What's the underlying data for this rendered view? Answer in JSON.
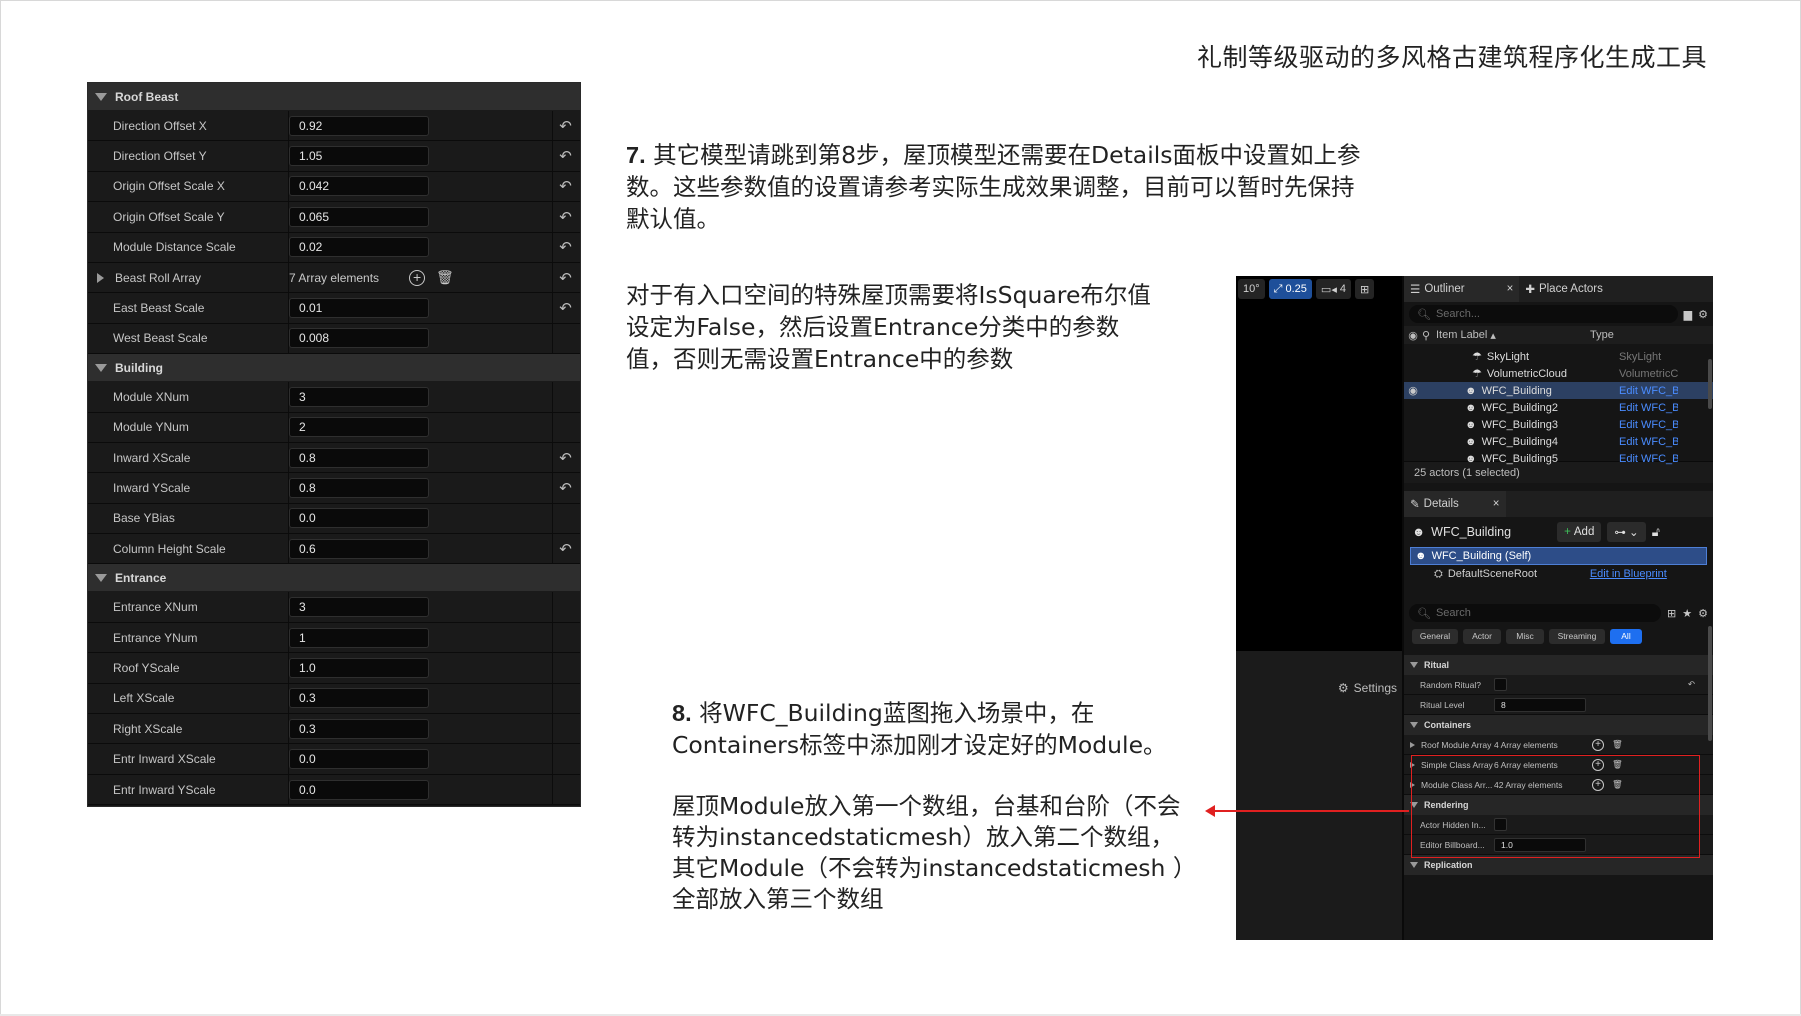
{
  "slide": {
    "title": "礼制等级驱动的多风格古建筑程序化生成工具"
  },
  "left_panel": {
    "sections": [
      {
        "name": "Roof Beast",
        "rows": [
          {
            "label": "Direction Offset X",
            "value": "0.92",
            "reset": true
          },
          {
            "label": "Direction Offset Y",
            "value": "1.05",
            "reset": true
          },
          {
            "label": "Origin Offset Scale X",
            "value": "0.042",
            "reset": true
          },
          {
            "label": "Origin Offset Scale Y",
            "value": "0.065",
            "reset": true
          },
          {
            "label": "Module Distance Scale",
            "value": "0.02",
            "reset": true
          },
          {
            "label": "Beast Roll Array",
            "value": "7 Array elements",
            "reset": true,
            "array": true
          },
          {
            "label": "East Beast Scale",
            "value": "0.01",
            "reset": true
          },
          {
            "label": "West Beast Scale",
            "value": "0.008",
            "reset": false
          }
        ]
      },
      {
        "name": "Building",
        "rows": [
          {
            "label": "Module XNum",
            "value": "3",
            "reset": false
          },
          {
            "label": "Module YNum",
            "value": "2",
            "reset": false
          },
          {
            "label": "Inward XScale",
            "value": "0.8",
            "reset": true
          },
          {
            "label": "Inward YScale",
            "value": "0.8",
            "reset": true
          },
          {
            "label": "Base YBias",
            "value": "0.0",
            "reset": false
          },
          {
            "label": "Column Height Scale",
            "value": "0.6",
            "reset": true
          }
        ]
      },
      {
        "name": "Entrance",
        "rows": [
          {
            "label": "Entrance XNum",
            "value": "3",
            "reset": false
          },
          {
            "label": "Entrance YNum",
            "value": "1",
            "reset": false
          },
          {
            "label": "Roof YScale",
            "value": "1.0",
            "reset": false
          },
          {
            "label": "Left XScale",
            "value": "0.3",
            "reset": false
          },
          {
            "label": "Right XScale",
            "value": "0.3",
            "reset": false
          },
          {
            "label": "Entr Inward XScale",
            "value": "0.0",
            "reset": false
          },
          {
            "label": "Entr Inward YScale",
            "value": "0.0",
            "reset": false
          }
        ]
      }
    ]
  },
  "text": {
    "step7_num": "7.",
    "step7_body": "其它模型请跳到第8步，屋顶模型还需要在Details面板中设置如上参数。这些参数值的设置请参考实际生成效果调整，目前可以暂时先保持默认值。",
    "entrance_note": "对于有入口空间的特殊屋顶需要将IsSquare布尔值设定为False，然后设置Entrance分类中的参数值，否则无需设置Entrance中的参数",
    "step8_num": "8.",
    "step8_body": "将WFC_Building蓝图拖入场景中，在Containers标签中添加刚才设定好的Module。",
    "roof_note": "屋顶Module放入第一个数组，台基和台阶（不会转为instancedstaticmesh）放入第二个数组，其它Module（不会转为instancedstaticmesh ）全部放入第三个数组"
  },
  "editor": {
    "viewport_chips": [
      "10°",
      "0.25",
      "4"
    ],
    "settings_label": "Settings",
    "outliner": {
      "tab": "Outliner",
      "tab2": "Place Actors",
      "search_placeholder": "Search...",
      "col_label": "Item Label",
      "col_type": "Type",
      "rows": [
        {
          "name": "SkyLight",
          "type": "SkyLight",
          "link": false,
          "selected": false
        },
        {
          "name": "VolumetricCloud",
          "type": "VolumetricCl",
          "link": false,
          "selected": false
        },
        {
          "name": "WFC_Building",
          "type": "Edit WFC_Bu",
          "link": true,
          "selected": true
        },
        {
          "name": "WFC_Building2",
          "type": "Edit WFC_Bu",
          "link": true,
          "selected": false
        },
        {
          "name": "WFC_Building3",
          "type": "Edit WFC_Bu",
          "link": true,
          "selected": false
        },
        {
          "name": "WFC_Building4",
          "type": "Edit WFC_Bu",
          "link": true,
          "selected": false
        },
        {
          "name": "WFC_Building5",
          "type": "Edit WFC_Bu",
          "link": true,
          "selected": false
        }
      ],
      "count": "25 actors (1 selected)"
    },
    "details": {
      "tab": "Details",
      "actor": "WFC_Building",
      "add_label": "Add",
      "self_label": "WFC_Building (Self)",
      "root_label": "DefaultSceneRoot",
      "edit_bp": "Edit in Blueprint",
      "search_placeholder": "Search",
      "categories": [
        "General",
        "Actor",
        "Misc",
        "Streaming",
        "All"
      ],
      "sections": [
        {
          "name": "Ritual",
          "rows": [
            {
              "label": "Random Ritual?",
              "kind": "check"
            },
            {
              "label": "Ritual Level",
              "kind": "value",
              "value": "8"
            }
          ]
        },
        {
          "name": "Containers",
          "rows": [
            {
              "label": "Roof Module Array",
              "kind": "array",
              "value": "4 Array elements"
            },
            {
              "label": "Simple Class Array",
              "kind": "array",
              "value": "6 Array elements"
            },
            {
              "label": "Module Class Arr...",
              "kind": "array",
              "value": "42 Array elements"
            }
          ]
        },
        {
          "name": "Rendering",
          "rows": [
            {
              "label": "Actor Hidden In...",
              "kind": "check"
            },
            {
              "label": "Editor Billboard...",
              "kind": "value",
              "value": "1.0"
            }
          ]
        },
        {
          "name": "Replication",
          "rows": []
        }
      ]
    }
  },
  "colors": {
    "accent_blue": "#1e6ff0",
    "link_blue": "#4a8cff",
    "highlight_red": "#e02020",
    "panel_bg": "#151515"
  }
}
